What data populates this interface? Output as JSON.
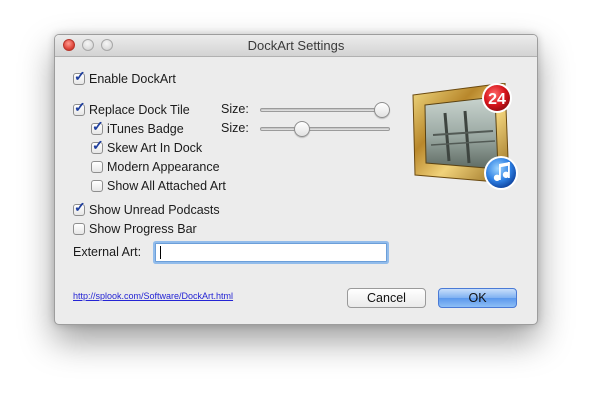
{
  "window": {
    "title": "DockArt Settings"
  },
  "options": {
    "enable_dockart": {
      "label": "Enable DockArt",
      "checked": true
    },
    "replace_dock_tile": {
      "label": "Replace Dock Tile",
      "checked": true
    },
    "itunes_badge": {
      "label": "iTunes Badge",
      "checked": true
    },
    "skew_art": {
      "label": "Skew Art In Dock",
      "checked": true
    },
    "modern_appearance": {
      "label": "Modern Appearance",
      "checked": false
    },
    "show_all_attached_art": {
      "label": "Show All Attached Art",
      "checked": false
    },
    "show_unread_podcasts": {
      "label": "Show Unread Podcasts",
      "checked": true
    },
    "show_progress_bar": {
      "label": "Show Progress Bar",
      "checked": false
    }
  },
  "sliders": {
    "tile_size": {
      "label": "Size:",
      "value": 1.0
    },
    "badge_size": {
      "label": "Size:",
      "value": 0.3
    }
  },
  "external_art": {
    "label": "External Art:",
    "value": ""
  },
  "preview": {
    "badge_count": "24"
  },
  "link": {
    "text": "http://splook.com/Software/DockArt.html"
  },
  "buttons": {
    "cancel": "Cancel",
    "ok": "OK"
  },
  "icons": {
    "close": "close-button",
    "minimize": "minimize-button",
    "zoom": "zoom-button",
    "checkmark": "checkmark-icon",
    "itunes": "itunes-icon"
  },
  "colors": {
    "accent_blue": "#5b98ec",
    "badge_red": "#d6141b",
    "link_blue": "#2424d4"
  }
}
